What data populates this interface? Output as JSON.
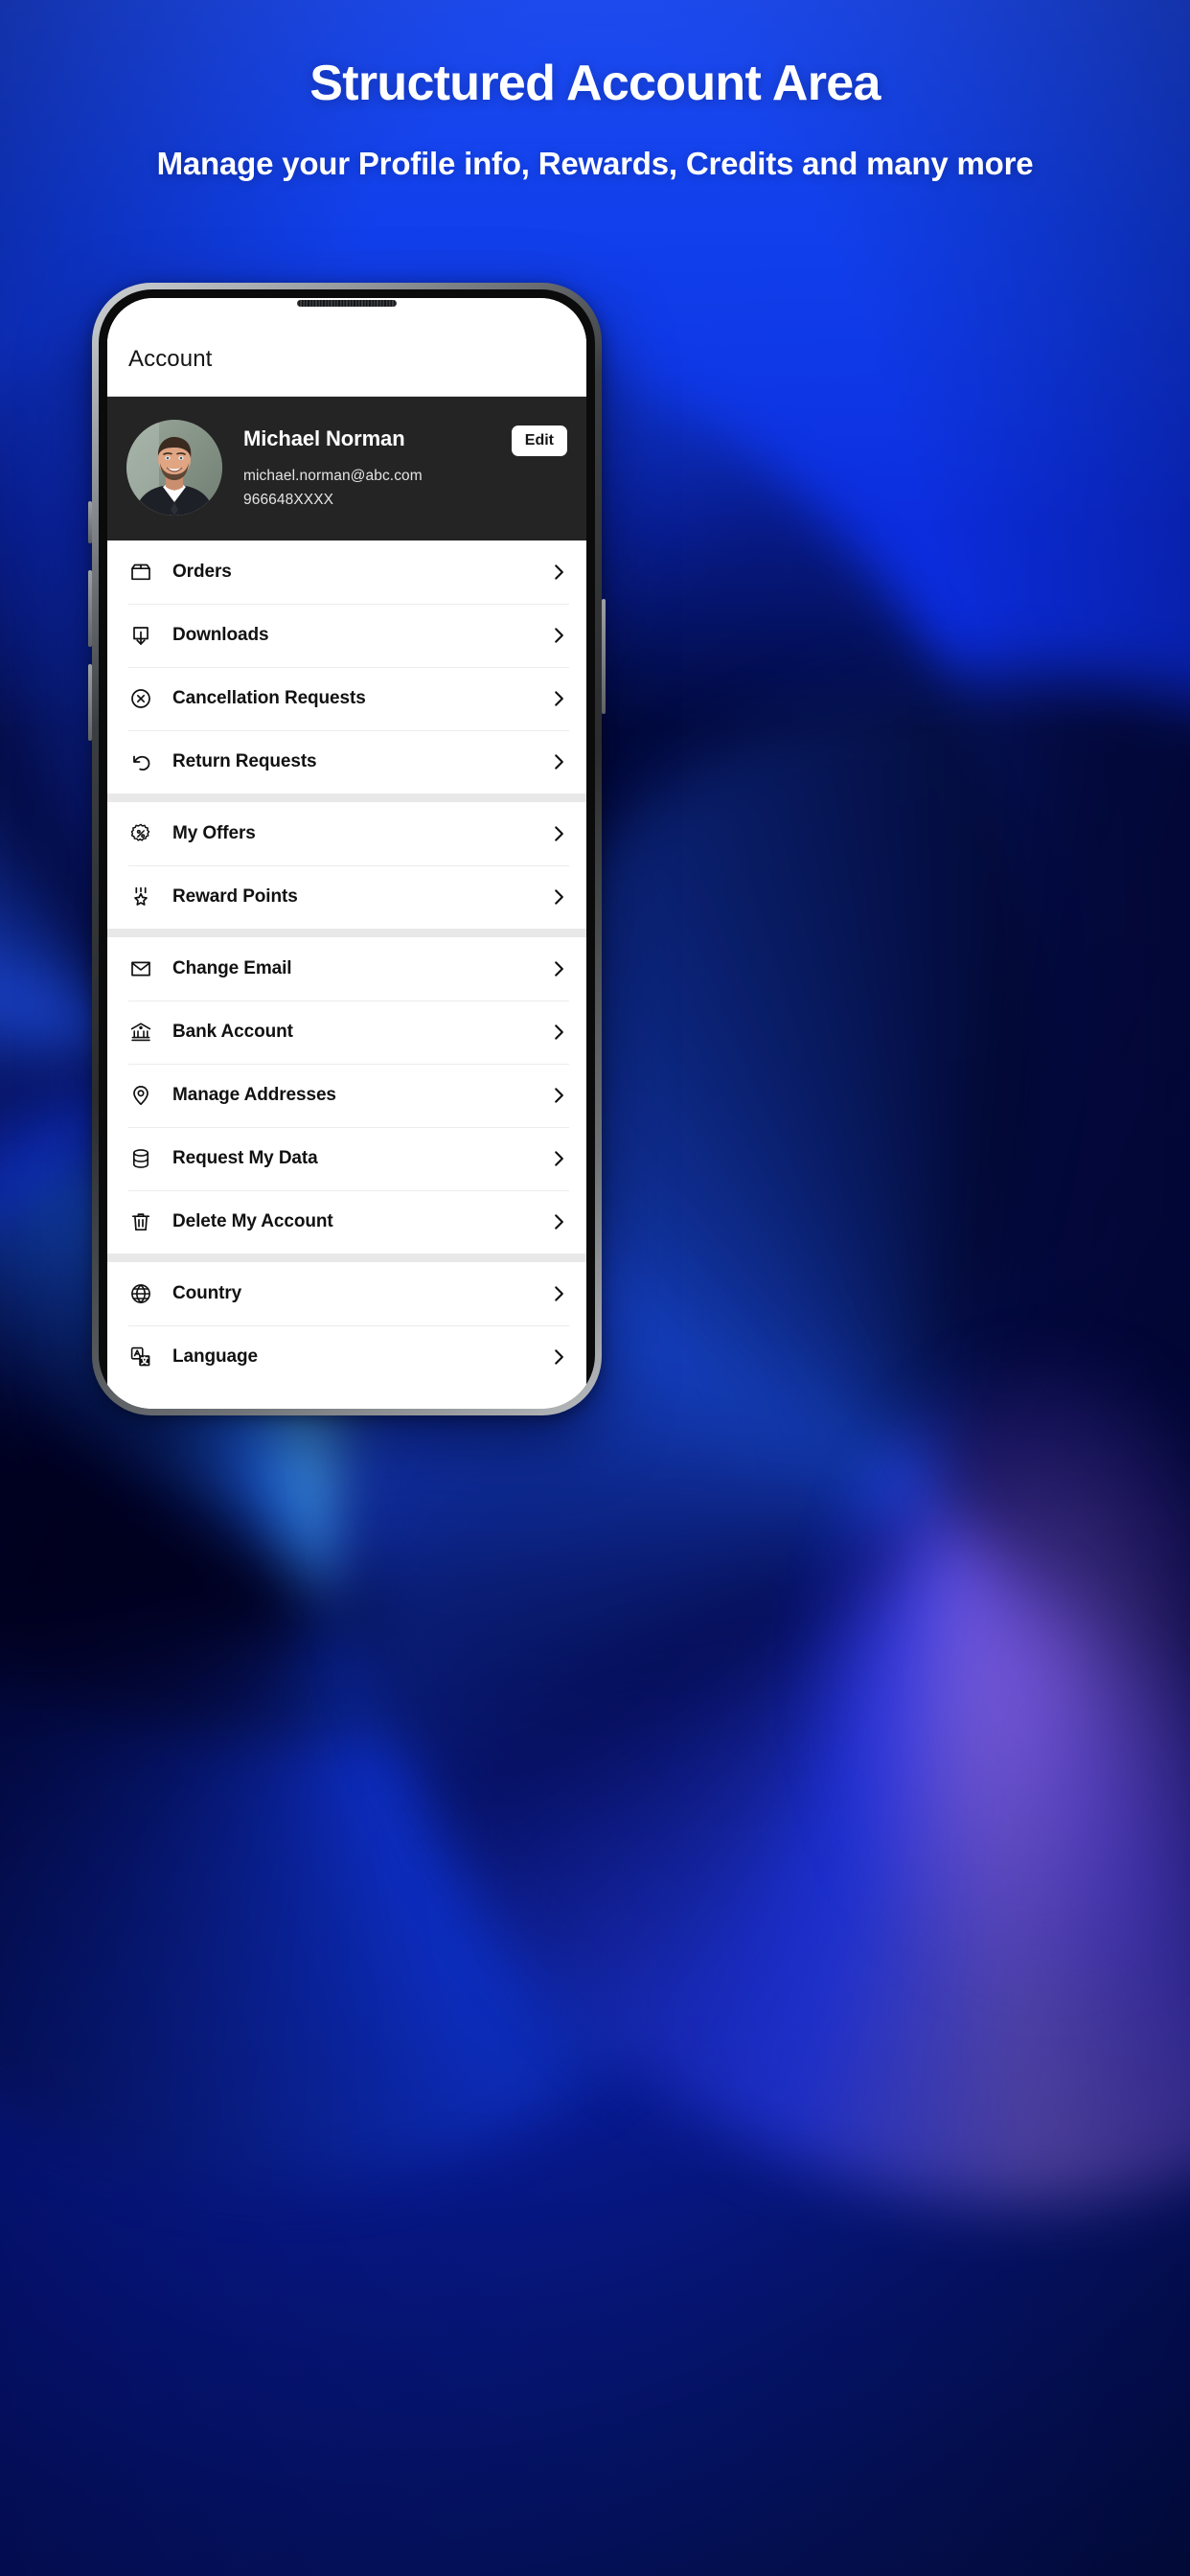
{
  "promo": {
    "title": "Structured Account Area",
    "subtitle": "Manage your Profile info, Rewards, Credits and many more"
  },
  "colors": {
    "background_blue": "#0a2ad8",
    "accent_blue": "#1440e8",
    "profile_card": "#242424",
    "group_divider": "#e8e8e8",
    "text_dark": "#111111"
  },
  "app": {
    "appbar": {
      "title": "Account"
    },
    "profile": {
      "name": "Michael Norman",
      "email": "michael.norman@abc.com",
      "phone": "966648XXXX",
      "edit_label": "Edit",
      "avatar_alt": "Michael Norman"
    },
    "menu_groups": [
      {
        "items": [
          {
            "label": "Orders",
            "icon": "package-icon"
          },
          {
            "label": "Downloads",
            "icon": "download-icon"
          },
          {
            "label": "Cancellation Requests",
            "icon": "circle-x-icon"
          },
          {
            "label": "Return Requests",
            "icon": "undo-arrow-icon"
          }
        ]
      },
      {
        "items": [
          {
            "label": "My Offers",
            "icon": "discount-badge-icon"
          },
          {
            "label": "Reward Points",
            "icon": "medal-star-icon"
          }
        ]
      },
      {
        "items": [
          {
            "label": "Change Email",
            "icon": "envelope-icon"
          },
          {
            "label": "Bank Account",
            "icon": "bank-icon"
          },
          {
            "label": "Manage Addresses",
            "icon": "map-pin-icon"
          },
          {
            "label": "Request My Data",
            "icon": "database-icon"
          },
          {
            "label": "Delete My Account",
            "icon": "trash-icon"
          }
        ]
      },
      {
        "items": [
          {
            "label": "Country",
            "icon": "globe-icon"
          },
          {
            "label": "Language",
            "icon": "translate-icon"
          }
        ]
      }
    ]
  }
}
